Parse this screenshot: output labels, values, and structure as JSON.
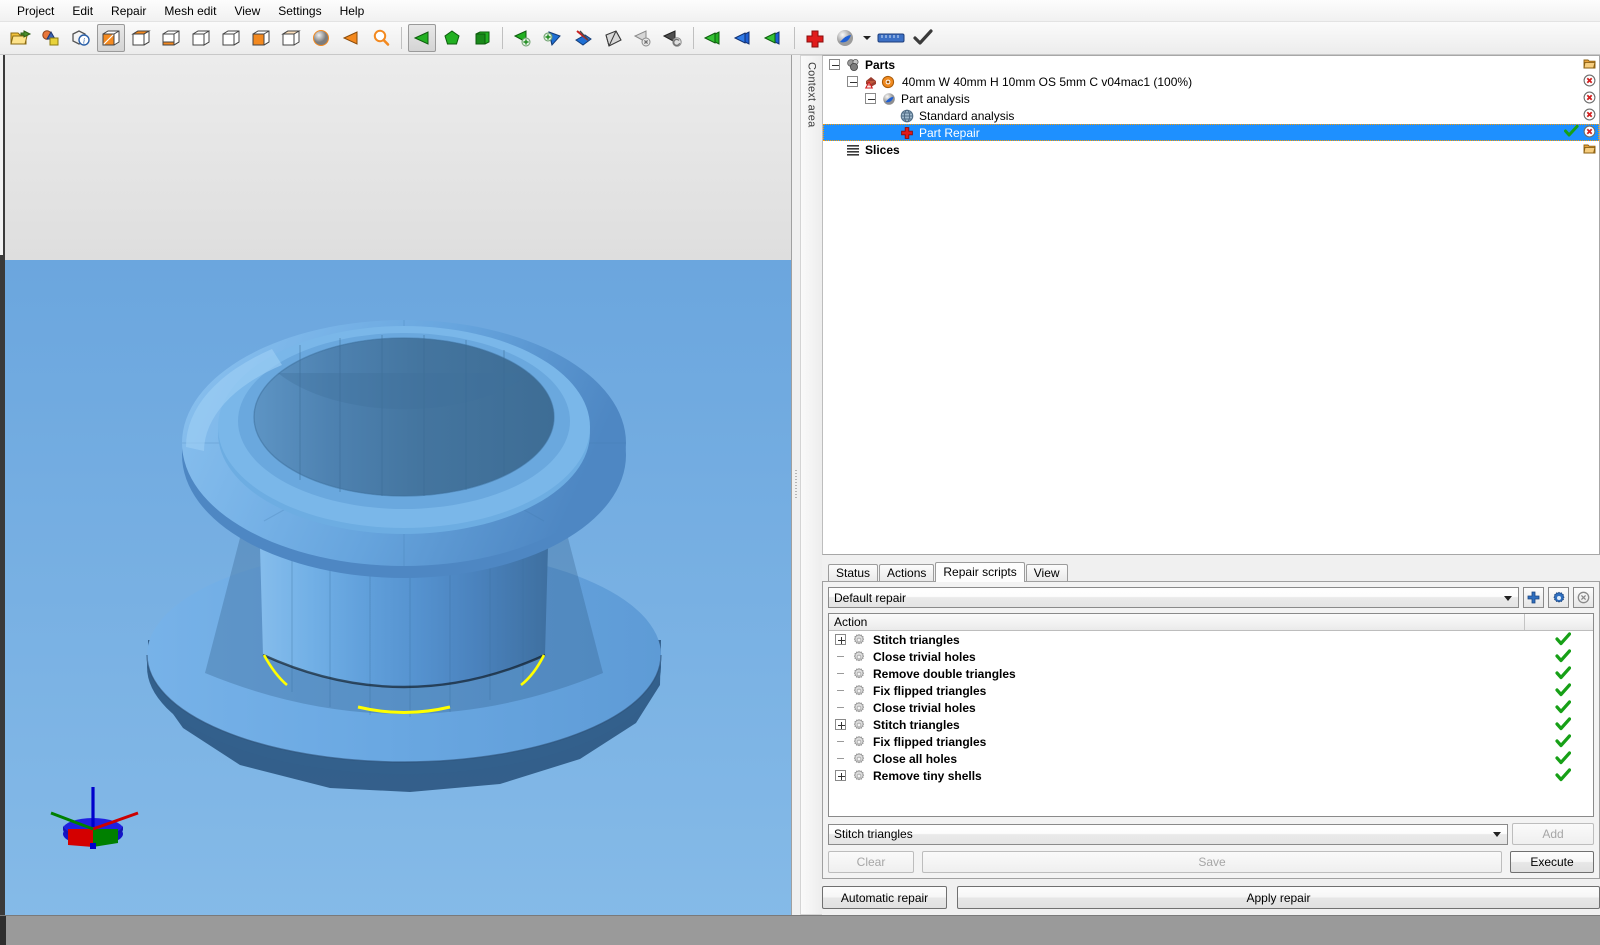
{
  "menubar": {
    "items": [
      {
        "label": "Project"
      },
      {
        "label": "Edit"
      },
      {
        "label": "Repair"
      },
      {
        "label": "Mesh edit"
      },
      {
        "label": "View"
      },
      {
        "label": "Settings"
      },
      {
        "label": "Help"
      }
    ]
  },
  "toolbar": {
    "groups": [
      {
        "buttons": [
          {
            "icon": "open-folder-icon",
            "active": false
          },
          {
            "icon": "import-part-icon",
            "active": false
          },
          {
            "icon": "part-info-icon",
            "active": false
          }
        ]
      },
      {
        "buttons": [
          {
            "icon": "view-shaded-icon",
            "active": true
          },
          {
            "icon": "view-top-icon",
            "active": false
          },
          {
            "icon": "view-front-icon",
            "active": false
          },
          {
            "icon": "view-left-icon",
            "active": false
          },
          {
            "icon": "view-right-icon",
            "active": false
          },
          {
            "icon": "view-back-icon",
            "active": false
          },
          {
            "icon": "view-bottom-icon",
            "active": false
          }
        ]
      },
      {
        "buttons": [
          {
            "icon": "render-sphere-icon",
            "active": false
          },
          {
            "icon": "orange-triangle-icon",
            "active": false
          },
          {
            "icon": "zoom-magnifier-icon",
            "active": false
          }
        ]
      },
      {
        "buttons": [
          {
            "icon": "select-triangle-icon",
            "active": true
          },
          {
            "icon": "select-polygon-icon",
            "active": false
          },
          {
            "icon": "select-surface-icon",
            "active": false
          }
        ]
      },
      {
        "buttons": [
          {
            "icon": "add-triangle-icon",
            "active": false
          },
          {
            "icon": "add-shell-icon",
            "active": false
          },
          {
            "icon": "cut-mesh-icon",
            "active": false
          },
          {
            "icon": "shell-gray-icon",
            "active": false
          },
          {
            "icon": "delete-triangle-icon",
            "active": false
          },
          {
            "icon": "undo-triangle-icon",
            "active": false
          }
        ]
      },
      {
        "buttons": [
          {
            "icon": "green-triangle-icon",
            "active": false
          },
          {
            "icon": "blue-triangle-icon",
            "active": false
          },
          {
            "icon": "greenblue-triangle-icon",
            "active": false
          }
        ]
      },
      {
        "buttons": [
          {
            "icon": "red-cross-repair-icon",
            "active": false
          },
          {
            "icon": "part-analysis-icon",
            "active": false
          },
          {
            "icon": "dropdown-arrow-icon",
            "active": false
          },
          {
            "icon": "measure-ruler-icon",
            "active": false
          },
          {
            "icon": "checkmark-icon",
            "active": false
          }
        ]
      }
    ]
  },
  "context_rail": {
    "label": "Context area"
  },
  "tree": {
    "nodes": [
      {
        "label": "Parts",
        "indent": 0,
        "bold": true,
        "expander": "minus",
        "icon": "parts-group-icon",
        "selected": false,
        "right_icons": [
          "folder-orange-icon"
        ]
      },
      {
        "label": "40mm W 40mm H 10mm OS 5mm C v04mac1 (100%)",
        "indent": 1,
        "bold": false,
        "expander": "minus",
        "icon": "part-warning-icon",
        "icon2": "eye-visible-icon",
        "selected": false,
        "right_icons": [
          "remove-circle-icon"
        ]
      },
      {
        "label": "Part analysis",
        "indent": 2,
        "bold": false,
        "expander": "minus",
        "icon": "part-analysis-blue-icon",
        "selected": false,
        "right_icons": [
          "remove-circle-icon"
        ]
      },
      {
        "label": "Standard analysis",
        "indent": 3,
        "bold": false,
        "expander": "none",
        "icon": "globe-analysis-icon",
        "selected": false,
        "right_icons": [
          "remove-circle-icon"
        ]
      },
      {
        "label": "Part Repair",
        "indent": 3,
        "bold": false,
        "expander": "none",
        "icon": "red-cross-repair-icon",
        "selected": true,
        "right_icons": [
          "green-check-icon",
          "remove-circle-icon"
        ]
      },
      {
        "label": "Slices",
        "indent": 0,
        "bold": true,
        "expander": "none",
        "icon": "slices-icon",
        "selected": false,
        "right_icons": [
          "folder-orange-icon"
        ]
      }
    ]
  },
  "bottom_panel": {
    "tabs": [
      {
        "label": "Status",
        "active": false
      },
      {
        "label": "Actions",
        "active": false
      },
      {
        "label": "Repair scripts",
        "active": true
      },
      {
        "label": "View",
        "active": false
      }
    ],
    "script_combo": {
      "value": "Default repair"
    },
    "script_buttons": [
      {
        "icon": "add-plus-icon",
        "name": "add-script-button"
      },
      {
        "icon": "gear-icon",
        "name": "script-settings-button"
      },
      {
        "icon": "delete-circle-icon",
        "name": "delete-script-button"
      }
    ],
    "action_list": {
      "columns": [
        "Action",
        ""
      ],
      "rows": [
        {
          "name": "Stitch triangles",
          "expander": "plus",
          "status": "ok"
        },
        {
          "name": "Close trivial holes",
          "expander": "none",
          "status": "ok"
        },
        {
          "name": "Remove double triangles",
          "expander": "none",
          "status": "ok"
        },
        {
          "name": "Fix flipped triangles",
          "expander": "none",
          "status": "ok"
        },
        {
          "name": "Close trivial holes",
          "expander": "none",
          "status": "ok"
        },
        {
          "name": "Stitch triangles",
          "expander": "plus",
          "status": "ok"
        },
        {
          "name": "Fix flipped triangles",
          "expander": "none",
          "status": "ok"
        },
        {
          "name": "Close all holes",
          "expander": "none",
          "status": "ok"
        },
        {
          "name": "Remove tiny shells",
          "expander": "plus",
          "status": "ok"
        }
      ]
    },
    "action_combo": {
      "value": "Stitch triangles"
    },
    "add_button": {
      "label": "Add",
      "enabled": false
    },
    "clear_button": {
      "label": "Clear",
      "enabled": false
    },
    "save_button": {
      "label": "Save",
      "enabled": false
    },
    "execute_button": {
      "label": "Execute",
      "enabled": true
    },
    "automatic_repair_button": {
      "label": "Automatic repair",
      "enabled": true
    },
    "apply_repair_button": {
      "label": "Apply repair",
      "enabled": true
    }
  },
  "viewport": {
    "model_name": "flange-bushing-part",
    "colors": {
      "background_top": "#e6e6e6",
      "background_bottom": "#6ba6de",
      "model_light": "#6fb0e8",
      "model_mid": "#4e8fc8",
      "model_dark": "#3d6f9e",
      "highlight_edge": "#ffff00"
    },
    "axis_gizmo": {
      "x_color": "#cc0000",
      "y_color": "#008000",
      "z_color": "#0000cc"
    }
  }
}
